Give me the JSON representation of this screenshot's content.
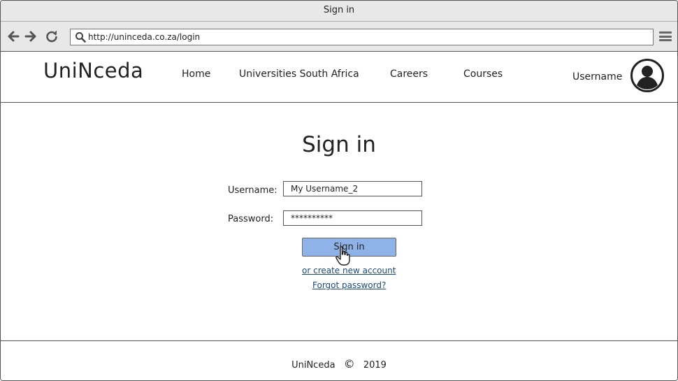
{
  "window": {
    "title": "Sign in"
  },
  "browser": {
    "back_icon": "arrow-left-icon",
    "forward_icon": "arrow-right-icon",
    "reload_icon": "reload-icon",
    "url": "http://uninceda.co.za/login",
    "menu_icon": "hamburger-menu-icon"
  },
  "header": {
    "logo": "UniNceda",
    "nav": [
      {
        "label": "Home"
      },
      {
        "label": "Universities South Africa"
      },
      {
        "label": "Careers"
      },
      {
        "label": "Courses"
      }
    ],
    "username": "Username",
    "avatar_icon": "user-avatar-icon"
  },
  "signin": {
    "title": "Sign in",
    "username_label": "Username:",
    "username_value": "My Username_2",
    "password_label": "Password:",
    "password_value": "**********",
    "button_label": "Sign in",
    "create_account_link": "or create new account",
    "forgot_password_link": "Forgot password?"
  },
  "footer": {
    "brand": "UniNceda",
    "copyright_symbol": "©",
    "year": "2019"
  },
  "colors": {
    "button_fill": "#8fb3e8",
    "link": "#1a4a80",
    "chrome": "#e8e8e8"
  }
}
